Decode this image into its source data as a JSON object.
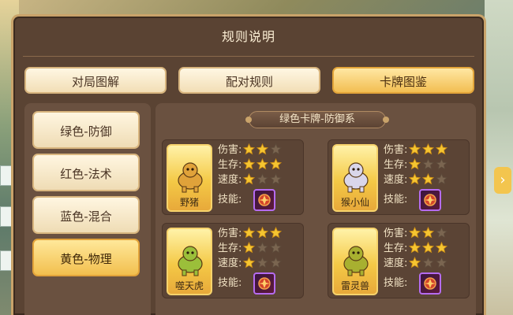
{
  "dialog": {
    "title": "规则说明"
  },
  "tabs": [
    {
      "label": "对局图解",
      "active": false
    },
    {
      "label": "配对规则",
      "active": false
    },
    {
      "label": "卡牌图鉴",
      "active": true
    }
  ],
  "sidebar": {
    "items": [
      {
        "label": "绿色-防御",
        "active": false
      },
      {
        "label": "红色-法术",
        "active": false
      },
      {
        "label": "蓝色-混合",
        "active": false
      },
      {
        "label": "黄色-物理",
        "active": true
      }
    ]
  },
  "section": {
    "title": "绿色卡牌-防御系"
  },
  "stat_labels": {
    "damage": "伤害:",
    "survival": "生存:",
    "speed": "速度:",
    "skill": "技能:"
  },
  "cards": [
    {
      "name": "野猪",
      "damage": 2,
      "survival": 3,
      "speed": 1,
      "creature_color": "#e0a23a"
    },
    {
      "name": "猴小仙",
      "damage": 3,
      "survival": 1,
      "speed": 2,
      "creature_color": "#d9d6ea"
    },
    {
      "name": "噬天虎",
      "damage": 3,
      "survival": 1,
      "speed": 1,
      "creature_color": "#9bbf3a"
    },
    {
      "name": "雷灵兽",
      "damage": 2,
      "survival": 3,
      "speed": 1,
      "creature_color": "#a8b030"
    }
  ],
  "max_stars": 3,
  "colors": {
    "star_filled": "#f5c531",
    "star_empty": "#7a6550",
    "accent": "#f2be52"
  }
}
